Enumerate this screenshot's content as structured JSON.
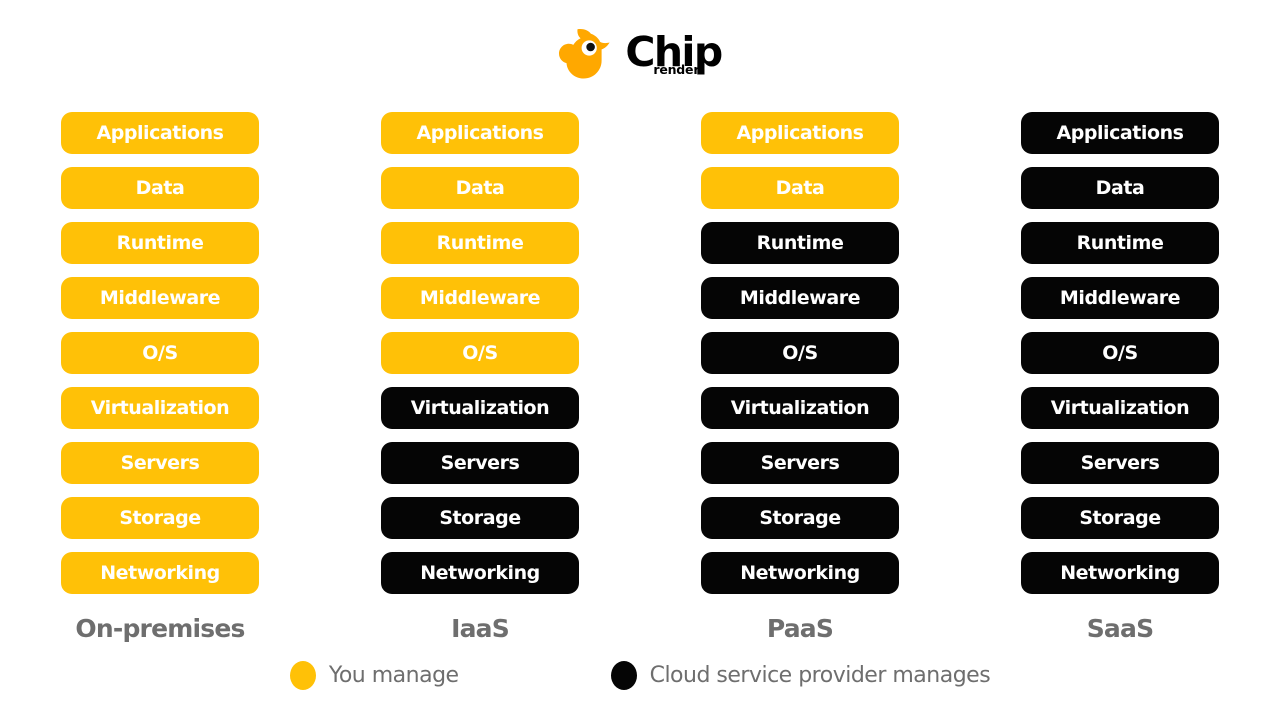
{
  "logo": {
    "mark_icon": "chick-bird-icon",
    "word": "Chip",
    "subword": "render",
    "brand_color": "#FFA800"
  },
  "diagram": {
    "layer_names": [
      "Applications",
      "Data",
      "Runtime",
      "Middleware",
      "O/S",
      "Virtualization",
      "Servers",
      "Storage",
      "Networking"
    ],
    "columns": [
      {
        "id": "on-premises",
        "label": "On-premises",
        "layers": [
          {
            "name": "Applications",
            "owner": "you"
          },
          {
            "name": "Data",
            "owner": "you"
          },
          {
            "name": "Runtime",
            "owner": "you"
          },
          {
            "name": "Middleware",
            "owner": "you"
          },
          {
            "name": "O/S",
            "owner": "you"
          },
          {
            "name": "Virtualization",
            "owner": "you"
          },
          {
            "name": "Servers",
            "owner": "you"
          },
          {
            "name": "Storage",
            "owner": "you"
          },
          {
            "name": "Networking",
            "owner": "you"
          }
        ]
      },
      {
        "id": "iaas",
        "label": "IaaS",
        "layers": [
          {
            "name": "Applications",
            "owner": "you"
          },
          {
            "name": "Data",
            "owner": "you"
          },
          {
            "name": "Runtime",
            "owner": "you"
          },
          {
            "name": "Middleware",
            "owner": "you"
          },
          {
            "name": "O/S",
            "owner": "you"
          },
          {
            "name": "Virtualization",
            "owner": "cloud"
          },
          {
            "name": "Servers",
            "owner": "cloud"
          },
          {
            "name": "Storage",
            "owner": "cloud"
          },
          {
            "name": "Networking",
            "owner": "cloud"
          }
        ]
      },
      {
        "id": "paas",
        "label": "PaaS",
        "layers": [
          {
            "name": "Applications",
            "owner": "you"
          },
          {
            "name": "Data",
            "owner": "you"
          },
          {
            "name": "Runtime",
            "owner": "cloud"
          },
          {
            "name": "Middleware",
            "owner": "cloud"
          },
          {
            "name": "O/S",
            "owner": "cloud"
          },
          {
            "name": "Virtualization",
            "owner": "cloud"
          },
          {
            "name": "Servers",
            "owner": "cloud"
          },
          {
            "name": "Storage",
            "owner": "cloud"
          },
          {
            "name": "Networking",
            "owner": "cloud"
          }
        ]
      },
      {
        "id": "saas",
        "label": "SaaS",
        "layers": [
          {
            "name": "Applications",
            "owner": "cloud"
          },
          {
            "name": "Data",
            "owner": "cloud"
          },
          {
            "name": "Runtime",
            "owner": "cloud"
          },
          {
            "name": "Middleware",
            "owner": "cloud"
          },
          {
            "name": "O/S",
            "owner": "cloud"
          },
          {
            "name": "Virtualization",
            "owner": "cloud"
          },
          {
            "name": "Servers",
            "owner": "cloud"
          },
          {
            "name": "Storage",
            "owner": "cloud"
          },
          {
            "name": "Networking",
            "owner": "cloud"
          }
        ]
      }
    ]
  },
  "legend": {
    "items": [
      {
        "id": "you",
        "label": "You manage",
        "color": "#FFC107"
      },
      {
        "id": "cloud",
        "label": "Cloud service provider manages",
        "color": "#050505"
      }
    ]
  },
  "colors": {
    "you_manage": "#FFC107",
    "cloud_manages": "#050505",
    "label_gray": "#6E6E6E",
    "background": "#FFFFFF"
  }
}
